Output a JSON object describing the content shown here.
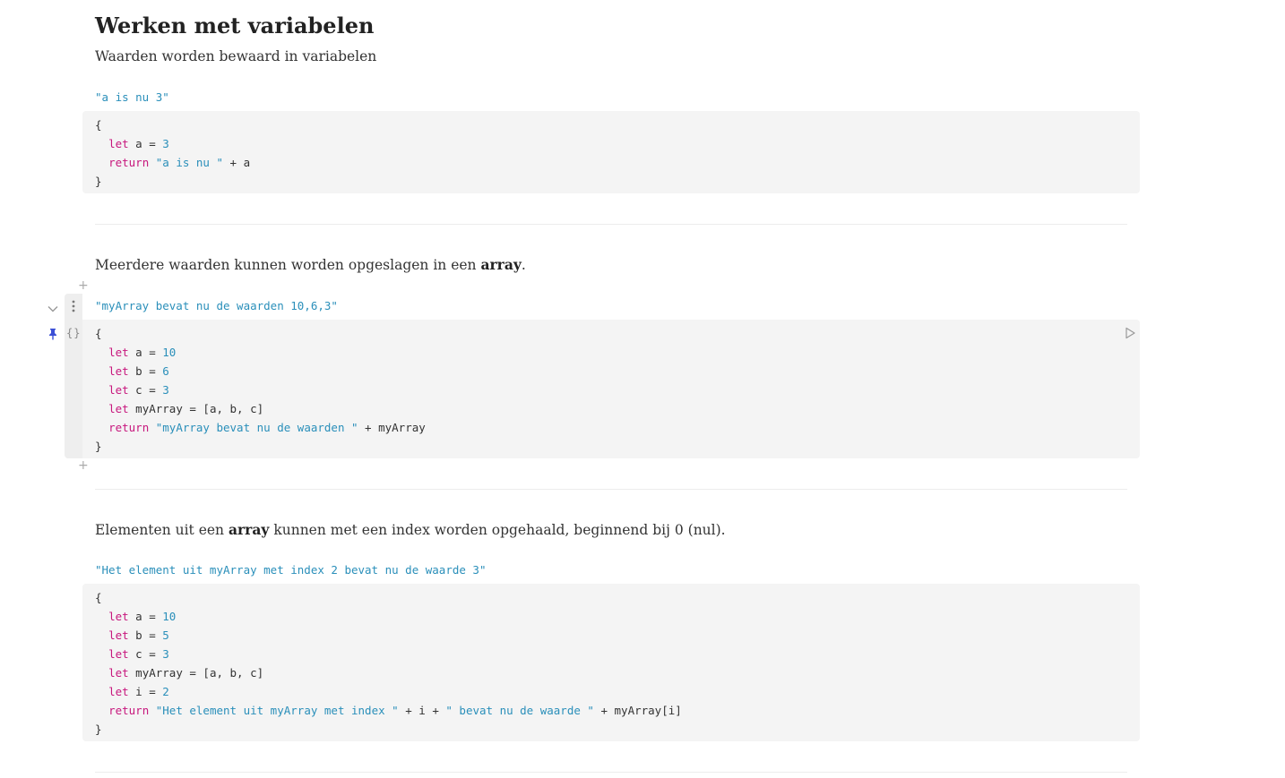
{
  "section": {
    "title": "Werken met variabelen",
    "intro": "Waarden worden bewaard in variabelen"
  },
  "cell1": {
    "output": "\"a is nu 3\"",
    "lines": [
      [
        {
          "t": "p",
          "v": "{"
        }
      ],
      [
        {
          "t": "p",
          "v": "  "
        },
        {
          "t": "kw",
          "v": "let"
        },
        {
          "t": "p",
          "v": " a = "
        },
        {
          "t": "num",
          "v": "3"
        }
      ],
      [
        {
          "t": "p",
          "v": "  "
        },
        {
          "t": "kw",
          "v": "return"
        },
        {
          "t": "p",
          "v": " "
        },
        {
          "t": "str",
          "v": "\"a is nu \""
        },
        {
          "t": "p",
          "v": " + a"
        }
      ],
      [
        {
          "t": "p",
          "v": "}"
        }
      ]
    ]
  },
  "para2": {
    "before": "Meerdere waarden kunnen worden opgeslagen in een ",
    "bold": "array",
    "after": "."
  },
  "cell2": {
    "output": "\"myArray bevat nu de waarden 10,6,3\"",
    "lines": [
      [
        {
          "t": "p",
          "v": "{"
        }
      ],
      [
        {
          "t": "p",
          "v": "  "
        },
        {
          "t": "kw",
          "v": "let"
        },
        {
          "t": "p",
          "v": " a = "
        },
        {
          "t": "num",
          "v": "10"
        }
      ],
      [
        {
          "t": "p",
          "v": "  "
        },
        {
          "t": "kw",
          "v": "let"
        },
        {
          "t": "p",
          "v": " b = "
        },
        {
          "t": "num",
          "v": "6"
        }
      ],
      [
        {
          "t": "p",
          "v": "  "
        },
        {
          "t": "kw",
          "v": "let"
        },
        {
          "t": "p",
          "v": " c = "
        },
        {
          "t": "num",
          "v": "3"
        }
      ],
      [
        {
          "t": "p",
          "v": "  "
        },
        {
          "t": "kw",
          "v": "let"
        },
        {
          "t": "p",
          "v": " myArray = [a, b, c]"
        }
      ],
      [
        {
          "t": "p",
          "v": "  "
        },
        {
          "t": "kw",
          "v": "return"
        },
        {
          "t": "p",
          "v": " "
        },
        {
          "t": "str",
          "v": "\"myArray bevat nu de waarden \""
        },
        {
          "t": "p",
          "v": " + myArray"
        }
      ],
      [
        {
          "t": "p",
          "v": "}"
        }
      ]
    ]
  },
  "para3": {
    "before": "Elementen uit een ",
    "bold": "array",
    "after": " kunnen met een index worden opgehaald, beginnend bij 0 (nul)."
  },
  "cell3": {
    "output": "\"Het element uit myArray met index 2 bevat nu de waarde 3\"",
    "lines": [
      [
        {
          "t": "p",
          "v": "{"
        }
      ],
      [
        {
          "t": "p",
          "v": "  "
        },
        {
          "t": "kw",
          "v": "let"
        },
        {
          "t": "p",
          "v": " a = "
        },
        {
          "t": "num",
          "v": "10"
        }
      ],
      [
        {
          "t": "p",
          "v": "  "
        },
        {
          "t": "kw",
          "v": "let"
        },
        {
          "t": "p",
          "v": " b = "
        },
        {
          "t": "num",
          "v": "5"
        }
      ],
      [
        {
          "t": "p",
          "v": "  "
        },
        {
          "t": "kw",
          "v": "let"
        },
        {
          "t": "p",
          "v": " c = "
        },
        {
          "t": "num",
          "v": "3"
        }
      ],
      [
        {
          "t": "p",
          "v": "  "
        },
        {
          "t": "kw",
          "v": "let"
        },
        {
          "t": "p",
          "v": " myArray = [a, b, c]"
        }
      ],
      [
        {
          "t": "p",
          "v": "  "
        },
        {
          "t": "kw",
          "v": "let"
        },
        {
          "t": "p",
          "v": " i = "
        },
        {
          "t": "num",
          "v": "2"
        }
      ],
      [
        {
          "t": "p",
          "v": "  "
        },
        {
          "t": "kw",
          "v": "return"
        },
        {
          "t": "p",
          "v": " "
        },
        {
          "t": "str",
          "v": "\"Het element uit myArray met index \""
        },
        {
          "t": "p",
          "v": " + i + "
        },
        {
          "t": "str",
          "v": "\" bevat nu de waarde \""
        },
        {
          "t": "p",
          "v": " + myArray[i]"
        }
      ],
      [
        {
          "t": "p",
          "v": "}"
        }
      ]
    ]
  },
  "gutter": {
    "add_above": "+",
    "add_below": "+",
    "collapse_icon": "chevron-down-icon",
    "menu_icon": "vertical-dots-icon",
    "pin_icon": "pin-icon",
    "source_icon": "code-braces-icon",
    "run_icon": "play-outline-icon",
    "source_glyph": "{}"
  },
  "colors": {
    "keyword": "#c7177d",
    "literal": "#2a8fba",
    "output": "#2a8fba",
    "pin": "#3b4fd6",
    "code_bg": "#f4f4f4"
  }
}
